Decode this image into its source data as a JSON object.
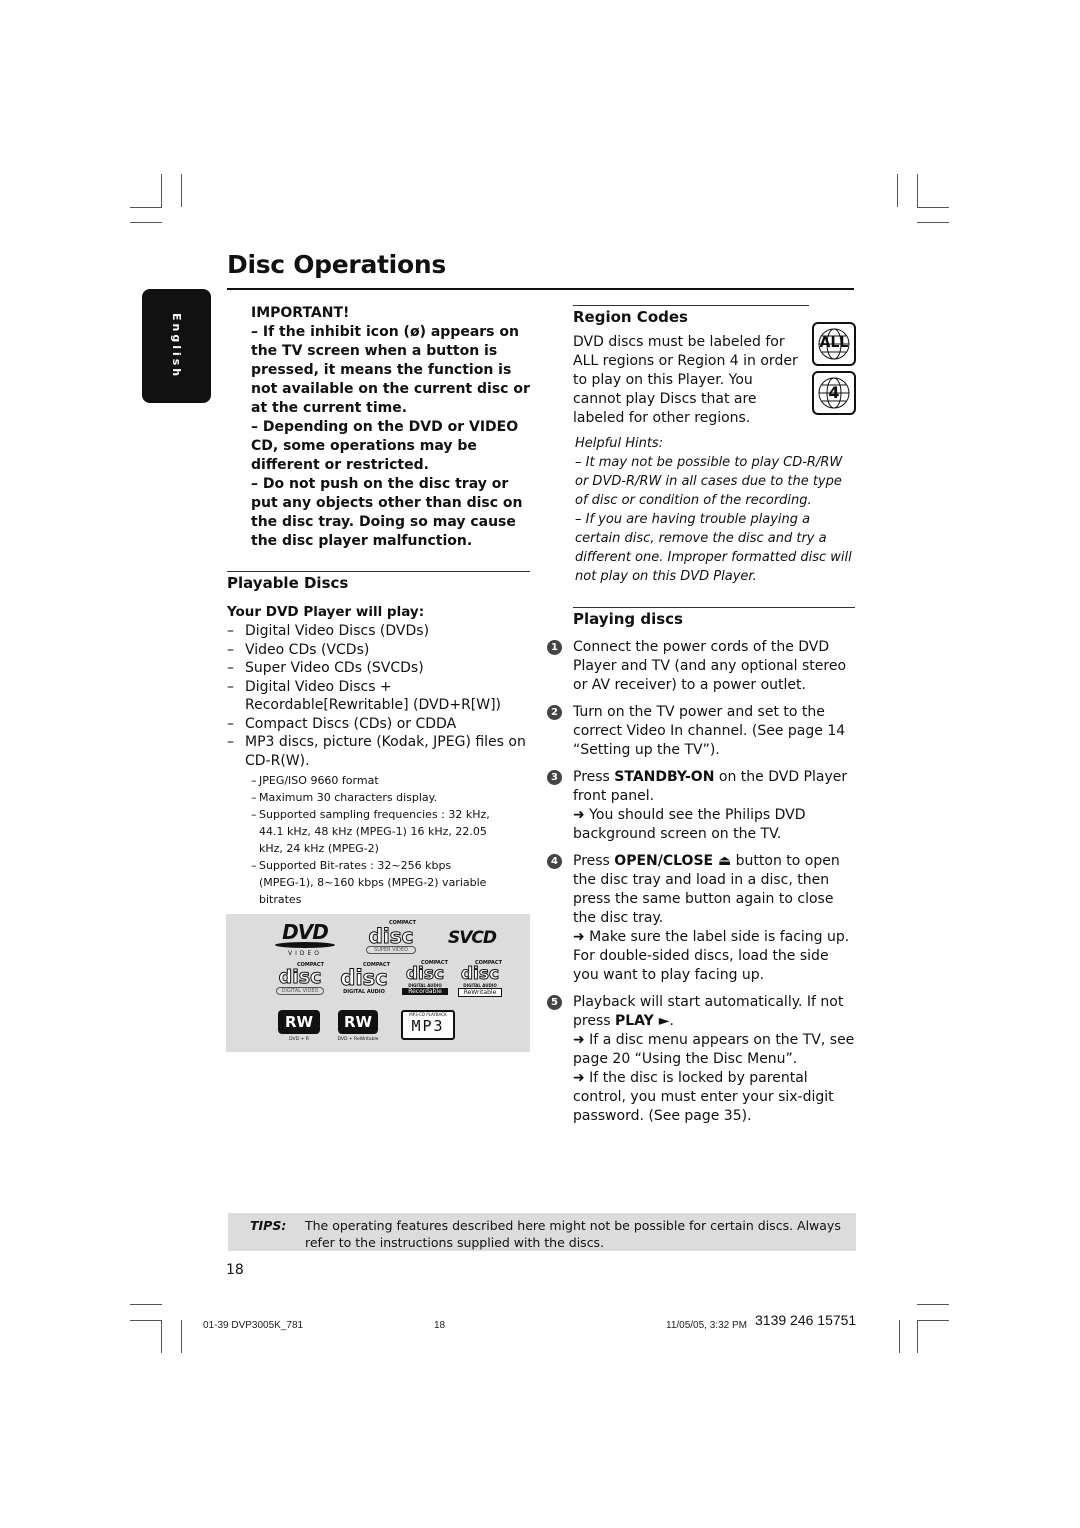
{
  "page": {
    "title": "Disc Operations",
    "language_tab": "English",
    "page_number": "18"
  },
  "important": {
    "heading": "IMPORTANT!",
    "items": [
      "–  If the inhibit icon (ø) appears on the TV screen when a button is pressed, it means the function is not available on the current disc or at the current time.",
      "–  Depending on the DVD or VIDEO CD, some operations may be different or restricted.",
      "–  Do not push on the disc tray or put any objects other than disc on the disc tray.  Doing so may cause the disc player malfunction."
    ]
  },
  "playable_discs": {
    "heading": "Playable Discs",
    "subheading": "Your DVD Player will play:",
    "items": [
      "Digital Video Discs (DVDs)",
      "Video CDs (VCDs)",
      "Super Video CDs (SVCDs)",
      "Digital Video Discs + Recordable[Rewritable] (DVD+R[W])",
      "Compact Discs (CDs) or CDDA",
      "MP3 discs, picture (Kodak, JPEG) files on CD-R(W)."
    ],
    "sub_items": [
      "JPEG/ISO 9660 format",
      "Maximum 30 characters display.",
      "Supported sampling frequencies : 32 kHz, 44.1 kHz, 48 kHz (MPEG-1) 16 kHz, 22.05 kHz, 24 kHz (MPEG-2)",
      "Supported Bit-rates : 32~256 kbps (MPEG-1), 8~160 kbps (MPEG-2) variable bitrates"
    ],
    "logos": {
      "dvd": "DVD",
      "dvd_sub": "VIDEO",
      "compact": "COMPACT",
      "disc": "disc",
      "super_video": "SUPER VIDEO",
      "svcd": "SVCD",
      "digital_video": "DIGITAL VIDEO",
      "digital_audio": "DIGITAL AUDIO",
      "recordable": "Recordable",
      "rewritable": "ReWritable",
      "rw": "RW",
      "dvd_r": "DVD + R",
      "dvd_rw": "DVD + ReWritable",
      "mp3_top": "MP3-CD PLAYBACK",
      "mp3": "MP3"
    }
  },
  "region_codes": {
    "heading": "Region Codes",
    "text": "DVD discs must be labeled for ALL regions or Region 4 in order to play on this Player. You cannot play Discs that are labeled for other regions.",
    "icons": [
      {
        "name": "region-all-icon",
        "label": "ALL"
      },
      {
        "name": "region-4-icon",
        "label": "4"
      }
    ],
    "hints_heading": "Helpful Hints:",
    "hints": [
      "–    It may not be possible to play CD-R/RW or DVD-R/RW in all cases due to the type of disc or condition of the recording.",
      "–    If you are having trouble playing a certain disc, remove the disc and try a different one.  Improper formatted disc will not play on this DVD Player."
    ]
  },
  "playing_discs": {
    "heading": "Playing discs",
    "steps": [
      {
        "num": "1",
        "pre": "Connect the power cords of the DVD Player and TV (and any optional stereo or AV receiver) to a power outlet.",
        "bold": "",
        "post": "",
        "notes": []
      },
      {
        "num": "2",
        "pre": "Turn on the TV power and set to the correct Video In channel.  (See page 14 “Setting up the TV”).",
        "bold": "",
        "post": "",
        "notes": []
      },
      {
        "num": "3",
        "pre": "Press ",
        "bold": "STANDBY-ON",
        "post": " on the DVD Player front panel.",
        "notes": [
          "➜ You should see the Philips DVD background screen on the TV."
        ]
      },
      {
        "num": "4",
        "pre": "Press ",
        "bold": "OPEN/CLOSE ⏏",
        "post": " button to open the disc tray and load in a disc, then press the same button again to close the disc tray.",
        "notes": [
          "➜ Make sure the label side is facing up. For double-sided discs, load the side you want to play facing up."
        ]
      },
      {
        "num": "5",
        "pre": "Playback will start automatically. If not press ",
        "bold": "PLAY ►",
        "post": ".",
        "notes": [
          "➜ If a disc menu appears on the TV, see page 20 “Using the Disc Menu”.",
          "➜ If the disc is locked by parental control, you must enter your six-digit password. (See page 35)."
        ]
      }
    ]
  },
  "tips": {
    "label": "TIPS:",
    "text": "The operating features described here might not be possible for certain discs.  Always refer to the instructions supplied with the discs."
  },
  "footer": {
    "file": "01-39 DVP3005K_781",
    "page": "18",
    "date": "11/05/05, 3:32 PM",
    "code": "3139 246 15751"
  }
}
